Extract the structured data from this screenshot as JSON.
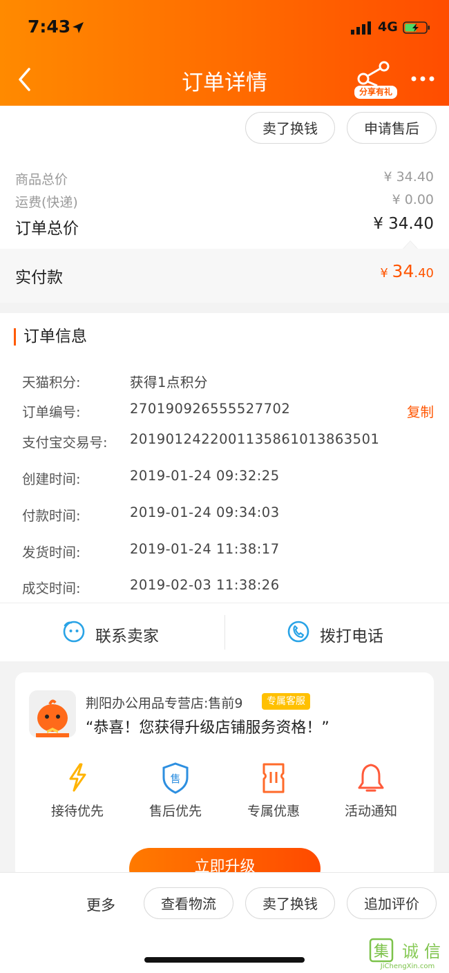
{
  "status_bar": {
    "time": "7:43",
    "network": "4G"
  },
  "nav": {
    "title": "订单详情",
    "share_label": "分享有礼"
  },
  "top_actions": {
    "sell_for_cash": "卖了换钱",
    "after_sales": "申请售后"
  },
  "price": {
    "goods_total_label": "商品总价",
    "goods_total_value": "¥ 34.40",
    "shipping_label": "运费(快递)",
    "shipping_value": "¥ 0.00",
    "order_total_label": "订单总价",
    "order_total_value": "¥ 34.40",
    "paid_label": "实付款",
    "paid_currency": "¥ ",
    "paid_int": "34",
    "paid_dec": ".40"
  },
  "order_info": {
    "title": "订单信息",
    "copy_label": "复制",
    "rows": [
      {
        "key": "天猫积分:",
        "value": "获得1点积分"
      },
      {
        "key": "订单编号:",
        "value": "270190926555527702"
      },
      {
        "key": "支付宝交易号:",
        "value": "2019012422001135861013863501"
      },
      {
        "key": "创建时间:",
        "value": "2019-01-24 09:32:25"
      },
      {
        "key": "付款时间:",
        "value": "2019-01-24 09:34:03"
      },
      {
        "key": "发货时间:",
        "value": "2019-01-24 11:38:17"
      },
      {
        "key": "成交时间:",
        "value": "2019-02-03 11:38:26"
      }
    ]
  },
  "contact": {
    "seller": "联系卖家",
    "phone": "拨打电话"
  },
  "service_card": {
    "shop_name": "荆阳办公用品专营店:售前9",
    "badge": "专属客服",
    "message": "“恭喜！您获得升级店铺服务资格！”",
    "perks": [
      {
        "label": "接待优先",
        "icon": "lightning-icon"
      },
      {
        "label": "售后优先",
        "icon": "shield-icon"
      },
      {
        "label": "专属优惠",
        "icon": "ticket-icon"
      },
      {
        "label": "活动通知",
        "icon": "bell-icon"
      }
    ],
    "upgrade_label": "立即升级"
  },
  "bottom_bar": {
    "more": "更多",
    "logistics": "查看物流",
    "sell_for_cash": "卖了换钱",
    "add_review": "追加评价"
  },
  "watermark": {
    "brand": "集诚信",
    "site": "JiChengXin.com"
  },
  "colors": {
    "accent": "#ff5500",
    "header_start": "#ff8a00",
    "header_end": "#ff4d00",
    "badge": "#ffc000",
    "watermark": "#7cc24a"
  }
}
